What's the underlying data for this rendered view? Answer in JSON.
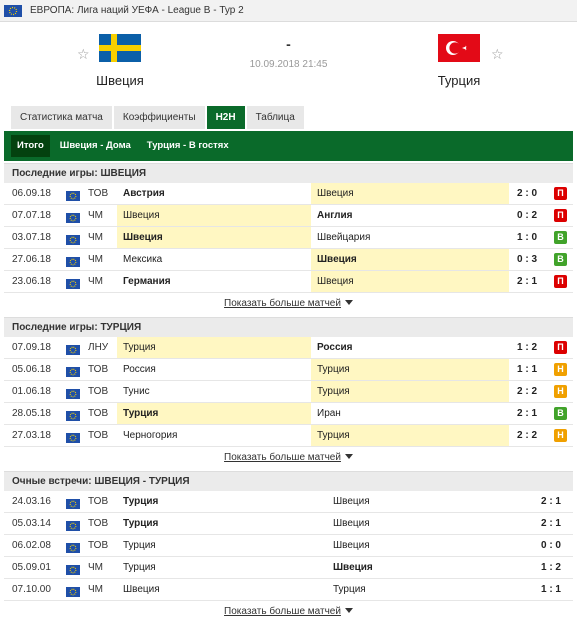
{
  "topbar": {
    "league": "ЕВРОПА: Лига наций УЕФА - League B - Тур 2"
  },
  "match": {
    "home_team": "Швеция",
    "away_team": "Турция",
    "score": "-",
    "datetime": "10.09.2018 21:45"
  },
  "colors": {
    "brand_green": "#0a6a2a",
    "highlight": "#fff7c2",
    "loss": "#dc0000",
    "win": "#41a32a",
    "draw": "#f0a000"
  },
  "tabs": [
    {
      "label": "Статистика матча"
    },
    {
      "label": "Коэффициенты"
    },
    {
      "label": "H2H"
    },
    {
      "label": "Таблица"
    }
  ],
  "subtabs": [
    {
      "label": "Итого"
    },
    {
      "label": "Швеция - Дома"
    },
    {
      "label": "Турция - В гостях"
    }
  ],
  "more_label": "Показать больше матчей",
  "sections": {
    "sweden": {
      "title": "Последние игры: ШВЕЦИЯ",
      "rows": [
        {
          "date": "06.09.18",
          "comp": "ТОВ",
          "home": "Австрия",
          "away": "Швеция",
          "score": "2 : 0",
          "result": "П"
        },
        {
          "date": "07.07.18",
          "comp": "ЧМ",
          "home": "Швеция",
          "away": "Англия",
          "score": "0 : 2",
          "result": "П"
        },
        {
          "date": "03.07.18",
          "comp": "ЧМ",
          "home": "Швеция",
          "away": "Швейцария",
          "score": "1 : 0",
          "result": "В"
        },
        {
          "date": "27.06.18",
          "comp": "ЧМ",
          "home": "Мексика",
          "away": "Швеция",
          "score": "0 : 3",
          "result": "В"
        },
        {
          "date": "23.06.18",
          "comp": "ЧМ",
          "home": "Германия",
          "away": "Швеция",
          "score": "2 : 1",
          "result": "П"
        }
      ]
    },
    "turkey": {
      "title": "Последние игры: ТУРЦИЯ",
      "rows": [
        {
          "date": "07.09.18",
          "comp": "ЛНУ",
          "home": "Турция",
          "away": "Россия",
          "score": "1 : 2",
          "result": "П"
        },
        {
          "date": "05.06.18",
          "comp": "ТОВ",
          "home": "Россия",
          "away": "Турция",
          "score": "1 : 1",
          "result": "Н"
        },
        {
          "date": "01.06.18",
          "comp": "ТОВ",
          "home": "Тунис",
          "away": "Турция",
          "score": "2 : 2",
          "result": "Н"
        },
        {
          "date": "28.05.18",
          "comp": "ТОВ",
          "home": "Турция",
          "away": "Иран",
          "score": "2 : 1",
          "result": "В"
        },
        {
          "date": "27.03.18",
          "comp": "ТОВ",
          "home": "Черногория",
          "away": "Турция",
          "score": "2 : 2",
          "result": "Н"
        }
      ]
    },
    "h2h": {
      "title": "Очные встречи: ШВЕЦИЯ - ТУРЦИЯ",
      "rows": [
        {
          "date": "24.03.16",
          "comp": "ТОВ",
          "home": "Турция",
          "away": "Швеция",
          "score": "2 : 1"
        },
        {
          "date": "05.03.14",
          "comp": "ТОВ",
          "home": "Турция",
          "away": "Швеция",
          "score": "2 : 1"
        },
        {
          "date": "06.02.08",
          "comp": "ТОВ",
          "home": "Турция",
          "away": "Швеция",
          "score": "0 : 0"
        },
        {
          "date": "05.09.01",
          "comp": "ЧМ",
          "home": "Турция",
          "away": "Швеция",
          "score": "1 : 2"
        },
        {
          "date": "07.10.00",
          "comp": "ЧМ",
          "home": "Швеция",
          "away": "Турция",
          "score": "1 : 1"
        }
      ]
    }
  }
}
